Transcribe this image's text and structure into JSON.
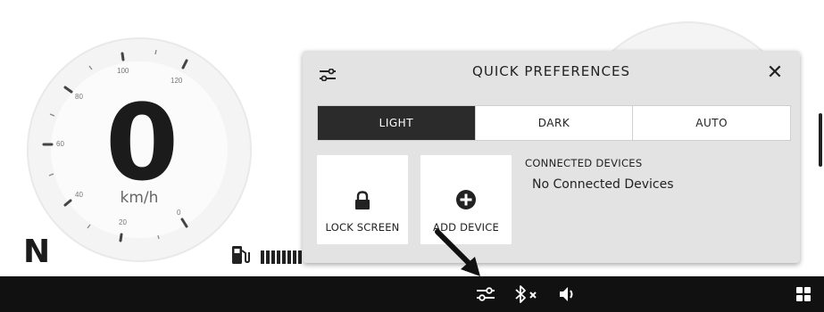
{
  "speedometer": {
    "speed": "0",
    "unit": "km/h",
    "scale_labels": [
      "0",
      "20",
      "40",
      "60",
      "80",
      "100",
      "120"
    ]
  },
  "gear": "N",
  "quick_preferences": {
    "title": "QUICK PREFERENCES",
    "close_glyph": "✕",
    "theme_options": [
      "LIGHT",
      "DARK",
      "AUTO"
    ],
    "selected_theme": "LIGHT",
    "tiles": {
      "lock_screen": "LOCK SCREEN",
      "add_device": "ADD DEVICE"
    },
    "connected_devices": {
      "heading": "CONNECTED DEVICES",
      "status": "No Connected Devices"
    }
  },
  "status_bar": {
    "icons": [
      "preferences-icon",
      "bluetooth-off-icon",
      "volume-icon",
      "apps-grid-icon"
    ]
  },
  "colors": {
    "status_bar": "#111111",
    "panel": "#e3e3e3",
    "active_segment": "#2b2b2b"
  }
}
